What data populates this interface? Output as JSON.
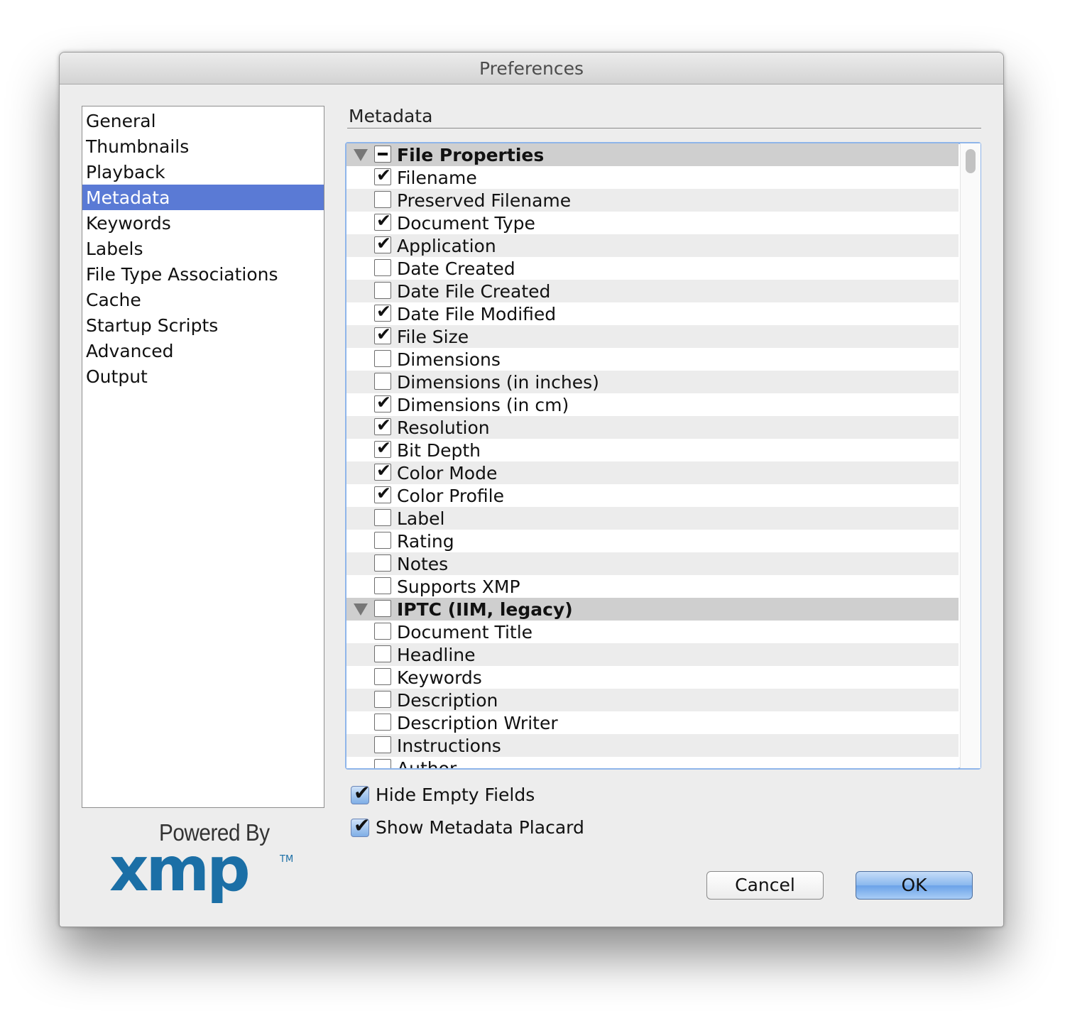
{
  "window": {
    "title": "Preferences"
  },
  "sidebar": {
    "items": [
      {
        "label": "General"
      },
      {
        "label": "Thumbnails"
      },
      {
        "label": "Playback"
      },
      {
        "label": "Metadata",
        "selected": true
      },
      {
        "label": "Keywords"
      },
      {
        "label": "Labels"
      },
      {
        "label": "File Type Associations"
      },
      {
        "label": "Cache"
      },
      {
        "label": "Startup Scripts"
      },
      {
        "label": "Advanced"
      },
      {
        "label": "Output"
      }
    ]
  },
  "logo": {
    "powered_by": "Powered By",
    "brand": "xmp",
    "trademark": "TM",
    "brand_color": "#1b6fa6"
  },
  "main": {
    "section_title": "Metadata",
    "rows": [
      {
        "label": "File Properties",
        "group": true,
        "state": "mixed"
      },
      {
        "label": "Filename",
        "checked": true
      },
      {
        "label": "Preserved Filename",
        "checked": false
      },
      {
        "label": "Document Type",
        "checked": true
      },
      {
        "label": "Application",
        "checked": true
      },
      {
        "label": "Date Created",
        "checked": false
      },
      {
        "label": "Date File Created",
        "checked": false
      },
      {
        "label": "Date File Modified",
        "checked": true
      },
      {
        "label": "File Size",
        "checked": true
      },
      {
        "label": "Dimensions",
        "checked": false
      },
      {
        "label": "Dimensions (in inches)",
        "checked": false
      },
      {
        "label": "Dimensions (in cm)",
        "checked": true
      },
      {
        "label": "Resolution",
        "checked": true
      },
      {
        "label": "Bit Depth",
        "checked": true
      },
      {
        "label": "Color Mode",
        "checked": true
      },
      {
        "label": "Color Profile",
        "checked": true
      },
      {
        "label": "Label",
        "checked": false
      },
      {
        "label": "Rating",
        "checked": false
      },
      {
        "label": "Notes",
        "checked": false
      },
      {
        "label": "Supports XMP",
        "checked": false
      },
      {
        "label": "IPTC (IIM, legacy)",
        "group": true,
        "state": "unchecked"
      },
      {
        "label": "Document Title",
        "checked": false
      },
      {
        "label": "Headline",
        "checked": false
      },
      {
        "label": "Keywords",
        "checked": false
      },
      {
        "label": "Description",
        "checked": false
      },
      {
        "label": "Description Writer",
        "checked": false
      },
      {
        "label": "Instructions",
        "checked": false
      },
      {
        "label": "Author",
        "checked": false
      }
    ],
    "options": [
      {
        "label": "Hide Empty Fields",
        "checked": true
      },
      {
        "label": "Show Metadata Placard",
        "checked": true
      }
    ]
  },
  "buttons": {
    "cancel": "Cancel",
    "ok": "OK"
  },
  "colors": {
    "selection": "#5a7ad5",
    "focus_ring": "#8fb5ea",
    "group_row": "#cfcfcf"
  }
}
